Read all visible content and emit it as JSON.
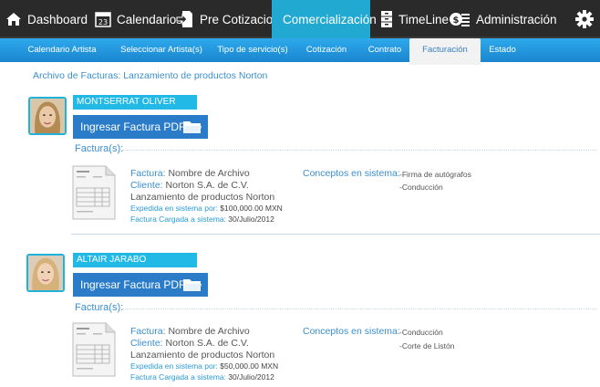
{
  "nav": {
    "items": [
      {
        "label": "Dashboard",
        "icon": "home-icon"
      },
      {
        "label": "Calendarios",
        "icon": "calendar-icon",
        "icon_text": "23"
      },
      {
        "label": "Pre Cotizaciones",
        "icon": "document-arrow-icon"
      },
      {
        "label": "Comercialización",
        "icon": "cloud-upload-icon",
        "active": true
      },
      {
        "label": "TimeLine",
        "icon": "cabinet-icon"
      },
      {
        "label": "Administración",
        "icon": "money-icon",
        "icon_text": "$"
      }
    ],
    "settings_icon": "gear-icon"
  },
  "subnav": {
    "tabs": [
      {
        "label": "Calendario Artista"
      },
      {
        "label": "Seleccionar Artista(s)"
      },
      {
        "label": "Tipo de servicio(s)"
      },
      {
        "label": "Cotización"
      },
      {
        "label": "Contrato"
      },
      {
        "label": "Facturación",
        "active": true
      },
      {
        "label": "Estado"
      }
    ]
  },
  "breadcrumb": "Archivo de Facturas:  Lanzamiento de productos Norton",
  "artists": [
    {
      "name": "MONTSERRAT OLIVER",
      "pdf_button": "Ingresar Factura PDF",
      "facturas_label": "Factura(s):",
      "invoice": {
        "factura_key": "Factura:",
        "factura_value": "Nombre de Archivo",
        "cliente_key": "Cliente:",
        "cliente_value": "Norton S.A. de C.V.",
        "project": "Lanzamiento de productos Norton",
        "expedida_key": "Expedida en sistema por:",
        "expedida_value": "$100,000.00 MXN",
        "cargada_key": "Factura Cargada a sistema:",
        "cargada_value": "30/Julio/2012",
        "conceptos_label": "Conceptos en sistema:",
        "conceptos": [
          "-Firma de autógrafos",
          "-Conducción"
        ]
      }
    },
    {
      "name": "ALTAIR JARABO",
      "pdf_button": "Ingresar Factura PDF",
      "facturas_label": "Factura(s):",
      "invoice": {
        "factura_key": "Factura:",
        "factura_value": "Nombre de Archivo",
        "cliente_key": "Cliente:",
        "cliente_value": "Norton S.A. de C.V.",
        "project": "Lanzamiento de productos Norton",
        "expedida_key": "Expedida en sistema por:",
        "expedida_value": "$50,000.00 MXN",
        "cargada_key": "Factura Cargada a sistema:",
        "cargada_value": "30/Julio/2012",
        "conceptos_label": "Conceptos en sistema:",
        "conceptos": [
          "-Conducción",
          "-Corte de Listón"
        ]
      }
    }
  ],
  "colors": {
    "nav_bg": "#2a2a2a",
    "nav_active": "#21a9d2",
    "subnav": "#1e8fd6",
    "accent": "#3a8fd0",
    "button": "#2a7cc9"
  }
}
